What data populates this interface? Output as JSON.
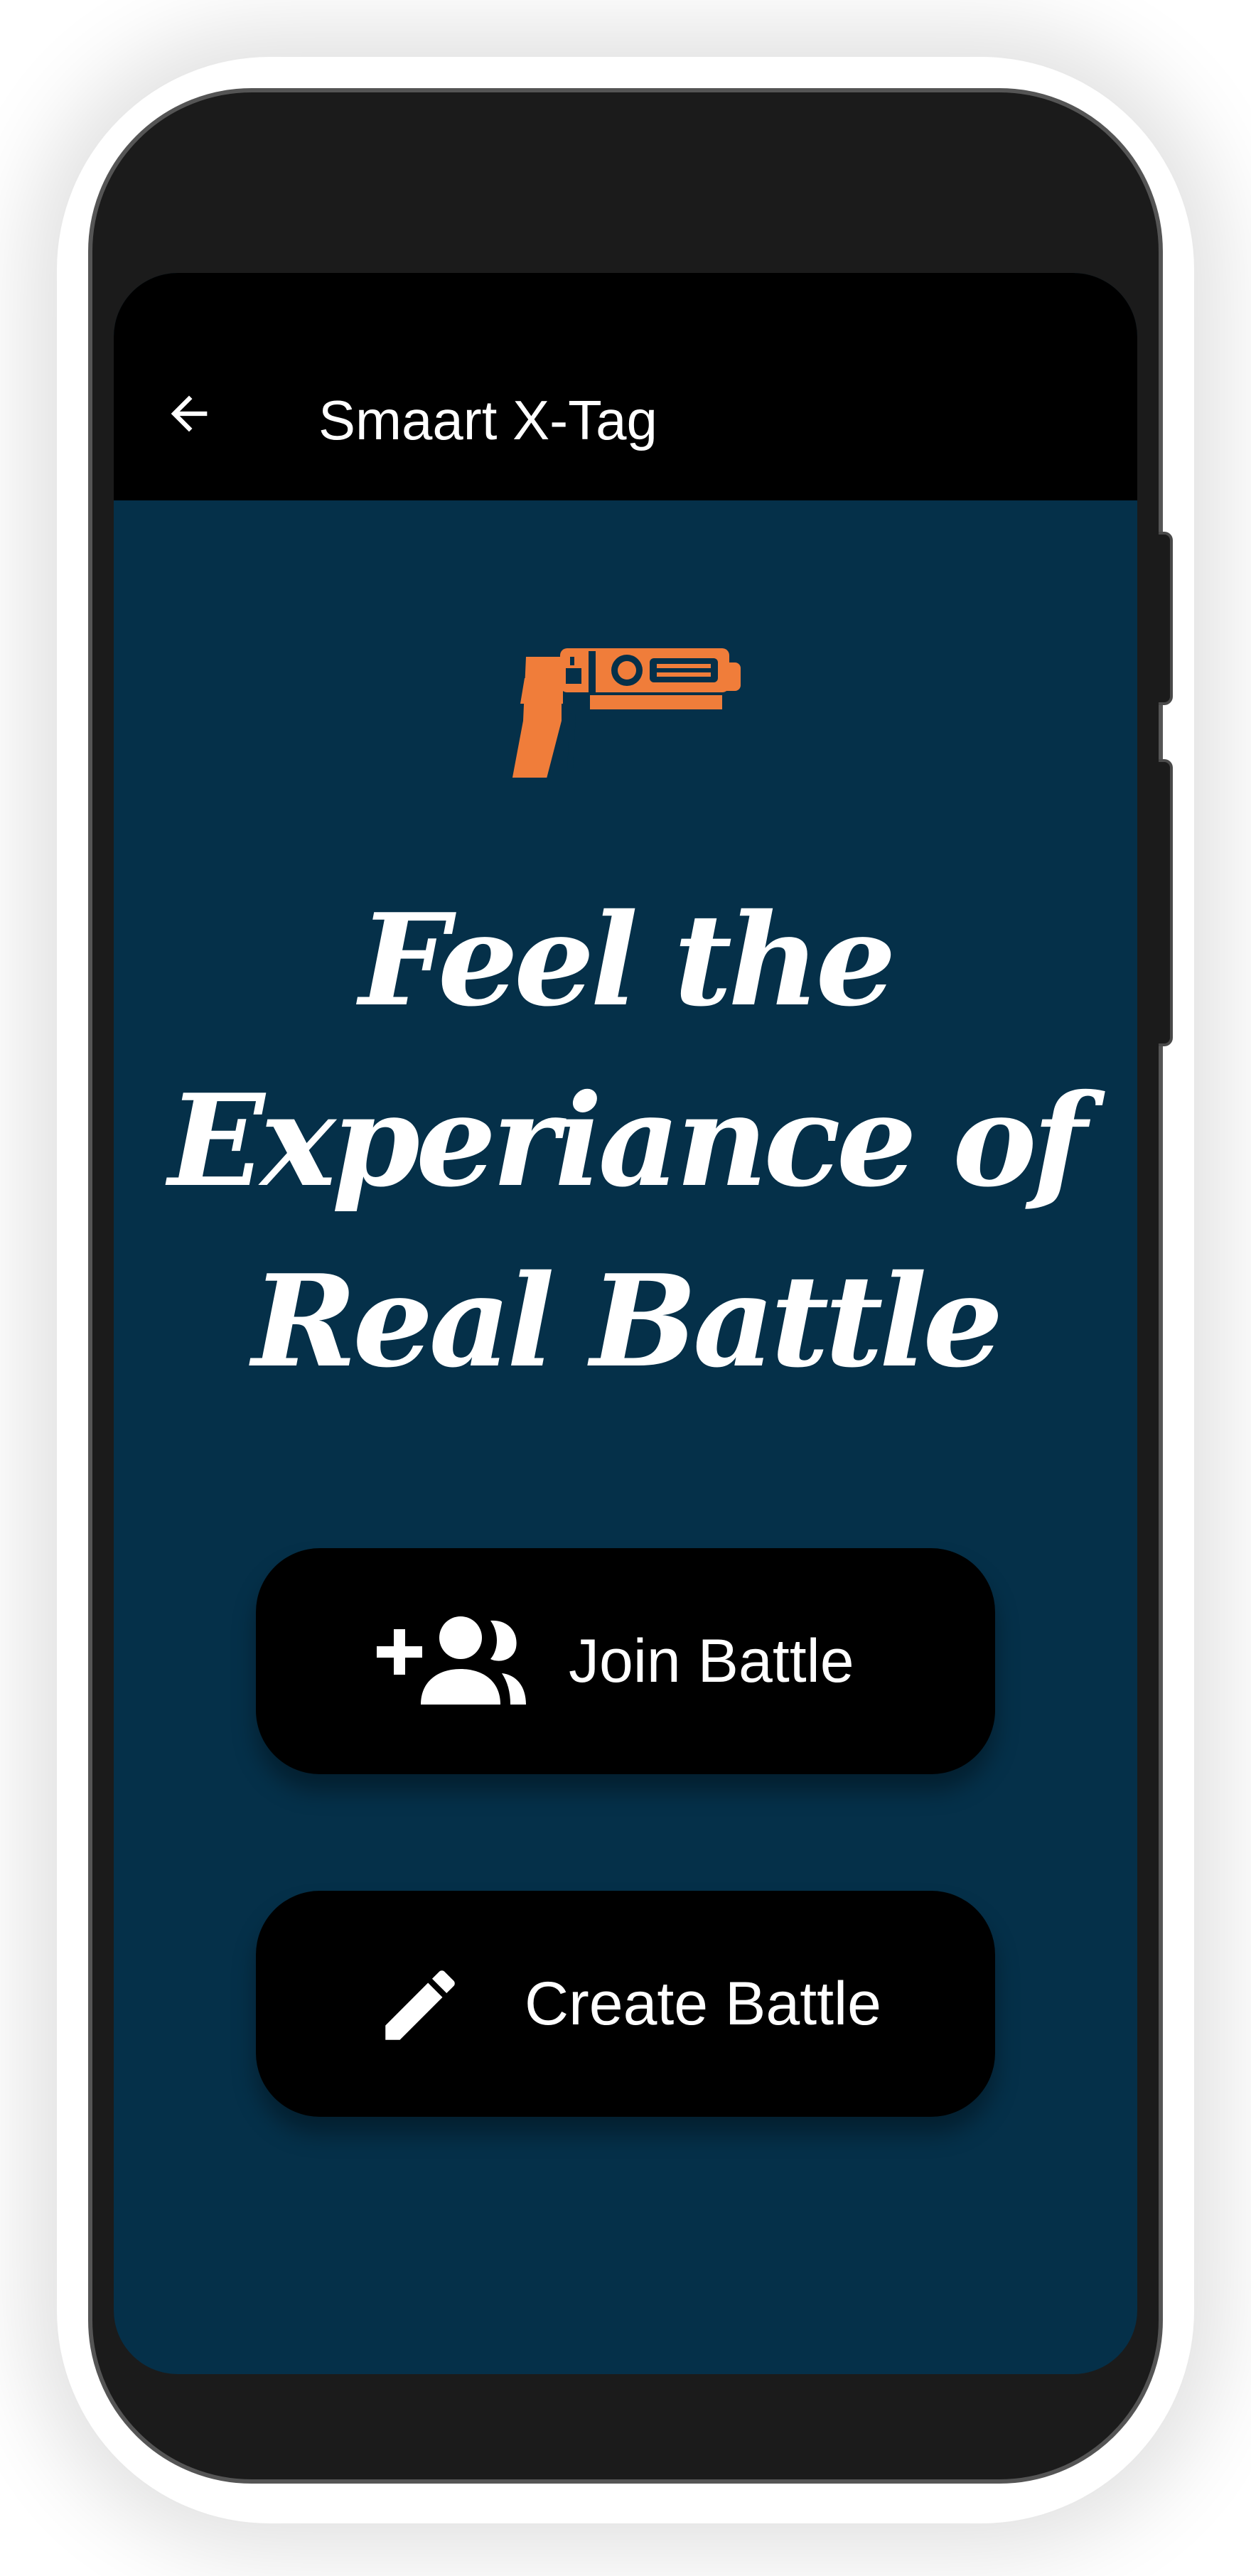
{
  "app": {
    "title": "Smaart X-Tag",
    "back_icon": "arrow-back-icon",
    "logo_icon": "laser-tag-gun-icon"
  },
  "hero": {
    "lines": [
      "Feel the",
      "Experiance of",
      "Real Battle"
    ]
  },
  "actions": {
    "join": {
      "label": "Join Battle",
      "icon": "add-group-icon"
    },
    "create": {
      "label": "Create Battle",
      "icon": "pencil-icon"
    }
  },
  "colors": {
    "screen_background": "#053049",
    "app_bar": "#000000",
    "button_background": "#000000",
    "logo_accent": "#f07d3a",
    "text": "#ffffff"
  }
}
